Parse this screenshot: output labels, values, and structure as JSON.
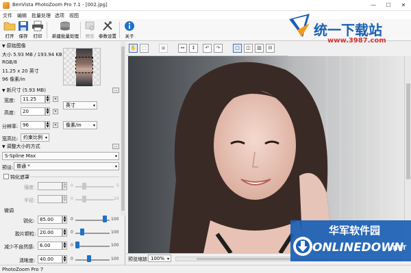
{
  "window": {
    "title": "BenVista PhotoZoom Pro 7.1 - [002.jpg]",
    "controls": [
      "—",
      "☐",
      "✕"
    ]
  },
  "menu": [
    "文件",
    "编辑",
    "批量处理",
    "选项",
    "视图"
  ],
  "toolbar": {
    "buttons": [
      "打开",
      "保存",
      "打印",
      "新建批量处理",
      "预览",
      "参数设置",
      "关于"
    ]
  },
  "original": {
    "header": "原始图像",
    "size": "大小 5.93 MB / 193.94 KB",
    "mode": "RGB/8",
    "dims": "11.25 x 20 英寸",
    "resolution": "96 像素/in"
  },
  "new_size": {
    "header": "新尺寸 (5.93 MB)",
    "width_label": "宽度:",
    "width_value": "11.25",
    "height_label": "高度:",
    "height_value": "20",
    "unit": "英寸",
    "res_label": "分辨率:",
    "res_value": "96",
    "res_unit": "像素/in",
    "aspect_label": "宽高比:",
    "aspect_value": "约束比例"
  },
  "resize_method": {
    "header": "调整大小的方式",
    "method": "S-Spline Max",
    "preset_label": "预设:",
    "preset_value": "普通 *",
    "sharpen_mask_label": "钝化遮罩",
    "strength_label": "强度:",
    "strength_max": "5",
    "radius_label": "半径:",
    "radius_max": "10",
    "fine_tune_label": "微调",
    "sharpness_label": "锐化:",
    "sharpness_value": "85.00",
    "sharpness_level": 0.85,
    "film_grain_label": "胶片颗粒:",
    "film_grain_value": "20.00",
    "film_grain_level": 0.2,
    "artifact_label": "减少不自然感:",
    "artifact_value": "6.00",
    "artifact_level": 0.06,
    "clarity_label": "清晰度:",
    "clarity_value": "40.00",
    "clarity_level": 0.4,
    "min": "0",
    "max": "100"
  },
  "preview": {
    "zoom_label": "预览缩放:",
    "zoom_value": "100%"
  },
  "status": "PhotoZoom Pro 7",
  "watermark_top": {
    "cn": "统一下载站",
    "url": "www.3987.com"
  },
  "watermark_bottom": {
    "cn": "华军软件园",
    "en": "ONLINEDOWN",
    "suffix": ".NET"
  },
  "colors": {
    "accent": "#1e72c8",
    "watermark_blue": "#1a5fb4",
    "watermark_red": "#e22b2b"
  }
}
